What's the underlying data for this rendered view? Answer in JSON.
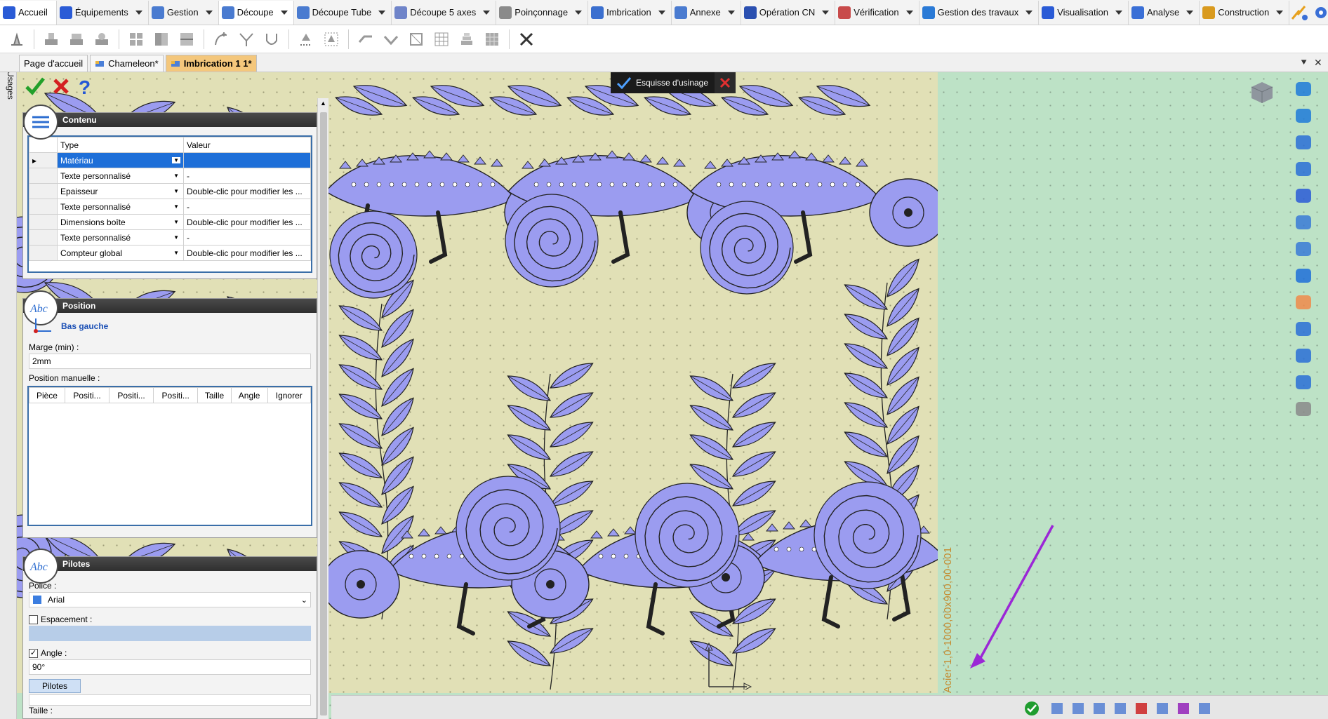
{
  "menu": {
    "items": [
      {
        "label": "Accueil",
        "icon": "home-icon",
        "active": true
      },
      {
        "label": "Équipements",
        "icon": "equipment-icon"
      },
      {
        "label": "Gestion",
        "icon": "management-icon"
      },
      {
        "label": "Découpe",
        "icon": "cutting-icon",
        "active": true
      },
      {
        "label": "Découpe Tube",
        "icon": "tube-cutting-icon"
      },
      {
        "label": "Découpe 5 axes",
        "icon": "five-axis-icon"
      },
      {
        "label": "Poinçonnage",
        "icon": "punching-icon"
      },
      {
        "label": "Imbrication",
        "icon": "nesting-icon"
      },
      {
        "label": "Annexe",
        "icon": "annex-icon"
      },
      {
        "label": "Opération CN",
        "icon": "cnc-icon"
      },
      {
        "label": "Vérification",
        "icon": "verify-icon"
      },
      {
        "label": "Gestion des travaux",
        "icon": "jobs-icon"
      },
      {
        "label": "Visualisation",
        "icon": "view-icon"
      },
      {
        "label": "Analyse",
        "icon": "analysis-icon"
      },
      {
        "label": "Construction",
        "icon": "construction-icon"
      }
    ]
  },
  "tabs": [
    {
      "label": "Page d'accueil"
    },
    {
      "label": "Chameleon*"
    },
    {
      "label": "Imbrication 1 1*",
      "active": true
    }
  ],
  "usages_label": "Usages",
  "banner": {
    "label": "Esquisse d'usinage"
  },
  "contenu": {
    "title": "Contenu",
    "columns": [
      "Type",
      "Valeur"
    ],
    "rows": [
      {
        "type": "Matériau",
        "value": ""
      },
      {
        "type": "Texte personnalisé",
        "value": "-"
      },
      {
        "type": "Epaisseur",
        "value": "Double-clic pour modifier les ..."
      },
      {
        "type": "Texte personnalisé",
        "value": "-"
      },
      {
        "type": "Dimensions boîte",
        "value": "Double-clic pour modifier les ..."
      },
      {
        "type": "Texte personnalisé",
        "value": "-"
      },
      {
        "type": "Compteur global",
        "value": "Double-clic pour modifier les ..."
      }
    ]
  },
  "position": {
    "title": "Position",
    "anchor": "Bas gauche",
    "margin_label": "Marge (min) :",
    "margin_value": "2mm",
    "manual_label": "Position manuelle :",
    "columns": [
      "Pièce",
      "Positi...",
      "Positi...",
      "Positi...",
      "Taille",
      "Angle",
      "Ignorer"
    ]
  },
  "pilotes": {
    "title": "Pilotes",
    "font_label": "Police :",
    "font_value": "Arial",
    "spacing_label": "Espacement :",
    "angle_label": "Angle :",
    "angle_value": "90°",
    "button_label": "Pilotes",
    "size_label": "Taille :"
  },
  "sheet": {
    "label": "Acier-1,0-1000,00x900,00-001",
    "scale": "50mm"
  },
  "colors": {
    "sheet": "#e1e0b6",
    "background": "#bde2c6",
    "parts": "#9b9cf0",
    "accent_tab": "#f4c77c",
    "arrow": "#9b27d6"
  }
}
